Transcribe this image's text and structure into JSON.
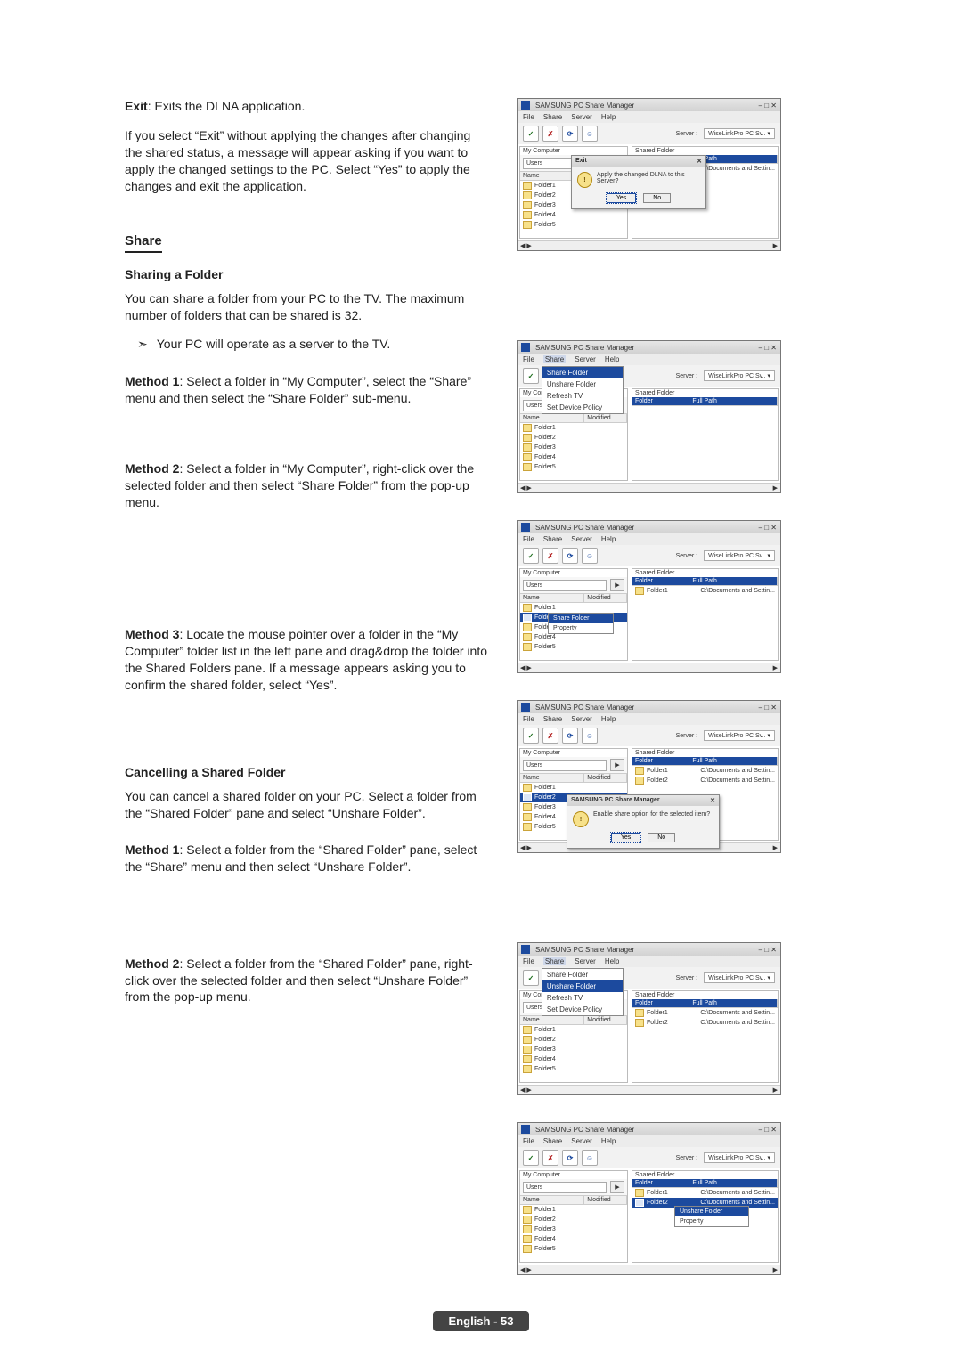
{
  "page": {
    "exit": {
      "label": "Exit",
      "desc": ": Exits the DLNA application.",
      "para": "If you select “Exit” without applying the changes after changing the shared status, a message will appear asking if you want to apply the changed settings to the PC. Select “Yes” to apply the changes and exit the application."
    },
    "share_heading": "Share",
    "sharing_sub": "Sharing a Folder",
    "sharing_para1": "You can share a folder from your PC to the TV.  The maximum number of folders that can be shared is 32.",
    "sharing_note": "Your PC will operate as a server to the TV.",
    "method1": {
      "label": "Method 1",
      "text": ": Select a folder in “My Computer”, select the “Share” menu and then select the “Share Folder” sub-menu."
    },
    "method2": {
      "label": "Method 2",
      "text": ": Select a folder in “My Computer”, right-click over the selected folder and then select “Share Folder” from the pop-up menu."
    },
    "method3": {
      "label": "Method 3",
      "text": ": Locate the mouse pointer over a folder in the “My Computer” folder list in the left pane and drag&drop the folder into the Shared Folders pane. If a message appears asking you to confirm the shared folder, select “Yes”."
    },
    "cancel_sub": "Cancelling a Shared Folder",
    "cancel_para": "You can cancel a shared folder on your PC. Select a folder from the “Shared Folder” pane and select “Unshare Folder”.",
    "cancel_m1": {
      "label": "Method 1",
      "text": ": Select a folder from the “Shared Folder” pane, select the “Share” menu and then select “Unshare Folder”."
    },
    "cancel_m2": {
      "label": "Method 2",
      "text": ": Select a folder from the “Shared Folder” pane, right-click over the selected folder and then select “Unshare Folder” from the pop-up menu."
    },
    "footer": "English - 53"
  },
  "win_common": {
    "title": "SAMSUNG PC Share Manager",
    "menus": [
      "File",
      "Share",
      "Server",
      "Help"
    ],
    "share_dropdown": {
      "share_folder": "Share Folder",
      "unshare_folder": "Unshare Folder",
      "refresh": "Refresh TV",
      "set_policy": "Set Device Policy"
    },
    "server_label": "Server :",
    "server_value": "WiseLinkPro PC Sv.. ▾",
    "left_label": "My Computer",
    "right_label": "Shared Folder",
    "combo_left": "Users",
    "col_name": "Name",
    "col_modified": "Modified",
    "col_folder": "Folder",
    "col_path": "Full Path",
    "folders": [
      "Folder1",
      "Folder2",
      "Folder3",
      "Folder4",
      "Folder5"
    ],
    "shared_row": {
      "folder": "Folder1",
      "path": "C:\\Documents and Settin..."
    },
    "shared_row2": {
      "folder": "Folder2",
      "path": "C:\\Documents and Settin..."
    }
  },
  "dlg_exit": {
    "title": "Exit",
    "msg": "Apply the changed DLNA to this Server?",
    "yes": "Yes",
    "no": "No"
  },
  "dlg_confirm": {
    "title": "SAMSUNG PC Share Manager",
    "msg": "Enable share option for the selected item?",
    "yes": "Yes",
    "no": "No"
  },
  "ctx_share": {
    "share": "Share Folder",
    "property": "Property"
  },
  "ctx_unshare": {
    "unshare": "Unshare Folder",
    "property": "Property"
  }
}
